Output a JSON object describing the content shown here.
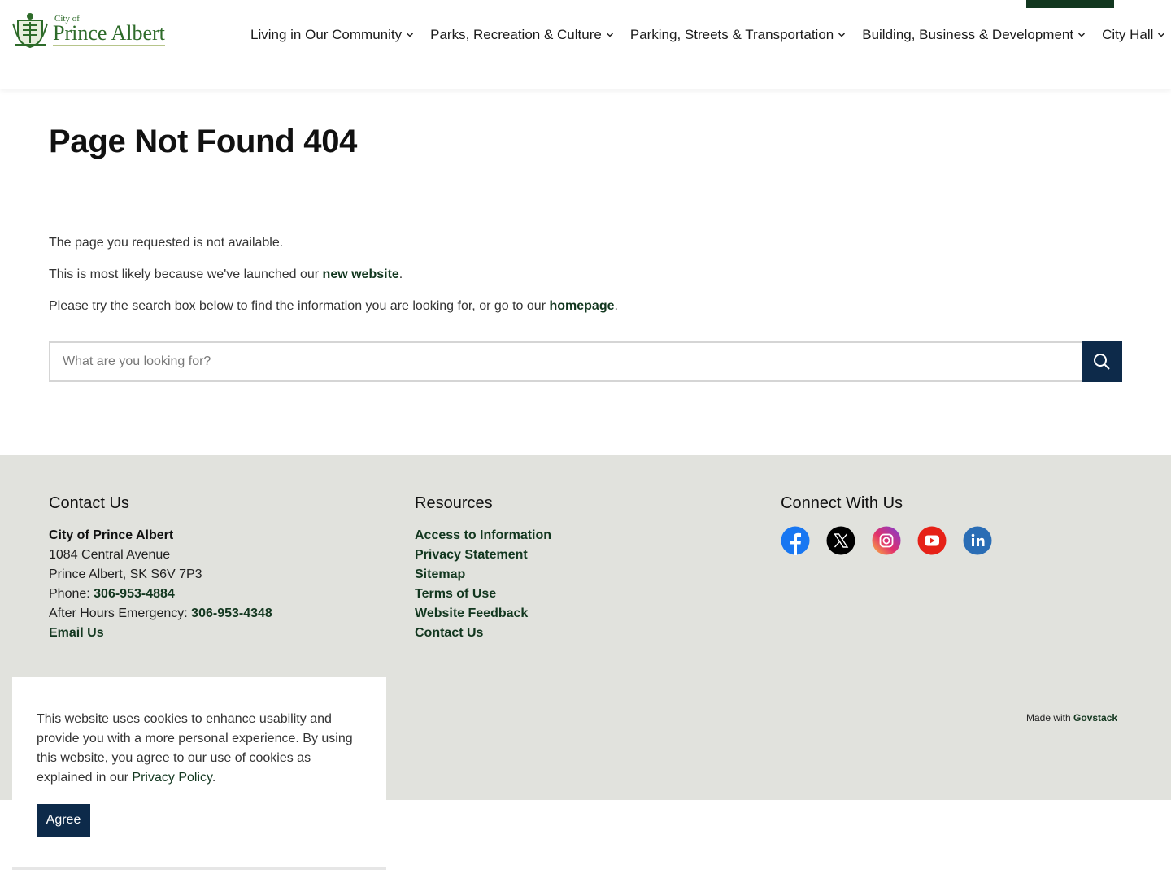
{
  "brand": {
    "small": "City of",
    "name": "Prince Albert"
  },
  "nav": {
    "items": [
      {
        "label": "Living in Our Community"
      },
      {
        "label": "Parks, Recreation & Culture"
      },
      {
        "label": "Parking, Streets & Transportation"
      },
      {
        "label": "Building, Business & Development"
      },
      {
        "label": "City Hall"
      }
    ]
  },
  "main": {
    "title": "Page Not Found 404",
    "line1": "The page you requested is not available.",
    "line2_prefix": "This is most likely because we've launched our ",
    "line2_link": "new website",
    "line2_suffix": ".",
    "line3_prefix": "Please try the search box below to find the information you are looking for, or go to our ",
    "line3_link": "homepage",
    "line3_suffix": ".",
    "search_placeholder": "What are you looking for?"
  },
  "footer": {
    "contact": {
      "heading": "Contact Us",
      "org": "City of Prince Albert",
      "address1": "1084 Central Avenue",
      "address2": "Prince Albert, SK S6V 7P3",
      "phone_label": "Phone: ",
      "phone": "306-953-4884",
      "emergency_label": "After Hours Emergency: ",
      "emergency": "306-953-4348",
      "email": "Email Us"
    },
    "resources": {
      "heading": "Resources",
      "links": [
        "Access to Information",
        "Privacy Statement",
        "Sitemap",
        "Terms of Use",
        "Website Feedback",
        "Contact Us"
      ]
    },
    "connect": {
      "heading": "Connect With Us",
      "icons": [
        "facebook-icon",
        "x-icon",
        "instagram-icon",
        "youtube-icon",
        "linkedin-icon"
      ]
    },
    "made_with_prefix": "Made with ",
    "made_with_link": "Govstack"
  },
  "cookie": {
    "text_prefix": "This website uses cookies to enhance usability and provide you with a more personal experience. By using this website, you agree to our use of cookies as explained in our ",
    "link": "Privacy Policy",
    "text_suffix": ".",
    "agree": "Agree"
  },
  "colors": {
    "brand_green": "#12371f",
    "logo_green": "#2e6b2a",
    "navy": "#0d2a4a",
    "footer_bg": "#e1e2dd"
  }
}
